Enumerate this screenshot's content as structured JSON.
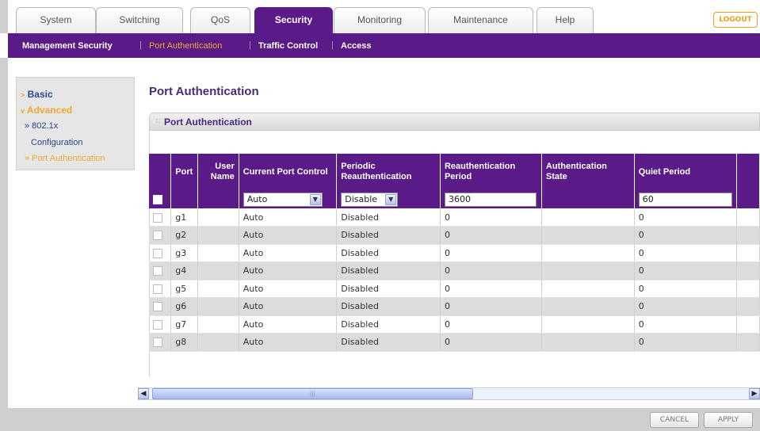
{
  "tabs": [
    {
      "label": "System"
    },
    {
      "label": "Switching"
    },
    {
      "label": "QoS"
    },
    {
      "label": "Security"
    },
    {
      "label": "Monitoring"
    },
    {
      "label": "Maintenance"
    },
    {
      "label": "Help"
    }
  ],
  "logout_label": "LOGOUT",
  "subnav": [
    {
      "label": "Management Security"
    },
    {
      "label": "Port Authentication"
    },
    {
      "label": "Traffic Control"
    },
    {
      "label": "Access"
    }
  ],
  "sidebar": {
    "basic": "Basic",
    "advanced": "Advanced",
    "dot1x": "» 802.1x",
    "dot1x_cont": "Configuration",
    "port_auth": "» Port Authentication"
  },
  "page_title": "Port Authentication",
  "panel_title": "Port Authentication",
  "table": {
    "headers": {
      "port": "Port",
      "user_name": "User Name",
      "current_port_control": "Current Port Control",
      "periodic_reauth": "Periodic Reauthentication",
      "reauth_period": "Reauthentication Period",
      "auth_state": "Authentication State",
      "quiet_period": "Quiet Period"
    },
    "edit": {
      "current_port_control": "Auto",
      "periodic_reauth": "Disable",
      "reauth_period": "3600",
      "quiet_period": "60"
    },
    "rows": [
      {
        "port": "g1",
        "control": "Auto",
        "periodic": "Disabled",
        "period": "0",
        "quiet": "0"
      },
      {
        "port": "g2",
        "control": "Auto",
        "periodic": "Disabled",
        "period": "0",
        "quiet": "0"
      },
      {
        "port": "g3",
        "control": "Auto",
        "periodic": "Disabled",
        "period": "0",
        "quiet": "0"
      },
      {
        "port": "g4",
        "control": "Auto",
        "periodic": "Disabled",
        "period": "0",
        "quiet": "0"
      },
      {
        "port": "g5",
        "control": "Auto",
        "periodic": "Disabled",
        "period": "0",
        "quiet": "0"
      },
      {
        "port": "g6",
        "control": "Auto",
        "periodic": "Disabled",
        "period": "0",
        "quiet": "0"
      },
      {
        "port": "g7",
        "control": "Auto",
        "periodic": "Disabled",
        "period": "0",
        "quiet": "0"
      },
      {
        "port": "g8",
        "control": "Auto",
        "periodic": "Disabled",
        "period": "0",
        "quiet": "0"
      }
    ]
  },
  "footer": {
    "cancel": "CANCEL",
    "apply": "APPLY"
  },
  "colors": {
    "brand_purple": "#5a1a87",
    "accent_orange": "#f0a830"
  },
  "icons": {
    "dropdown": "chevron-down-icon",
    "scroll_left": "arrow-left-icon",
    "scroll_right": "arrow-right-icon",
    "nav_arrow": "chevron-right-icon"
  }
}
